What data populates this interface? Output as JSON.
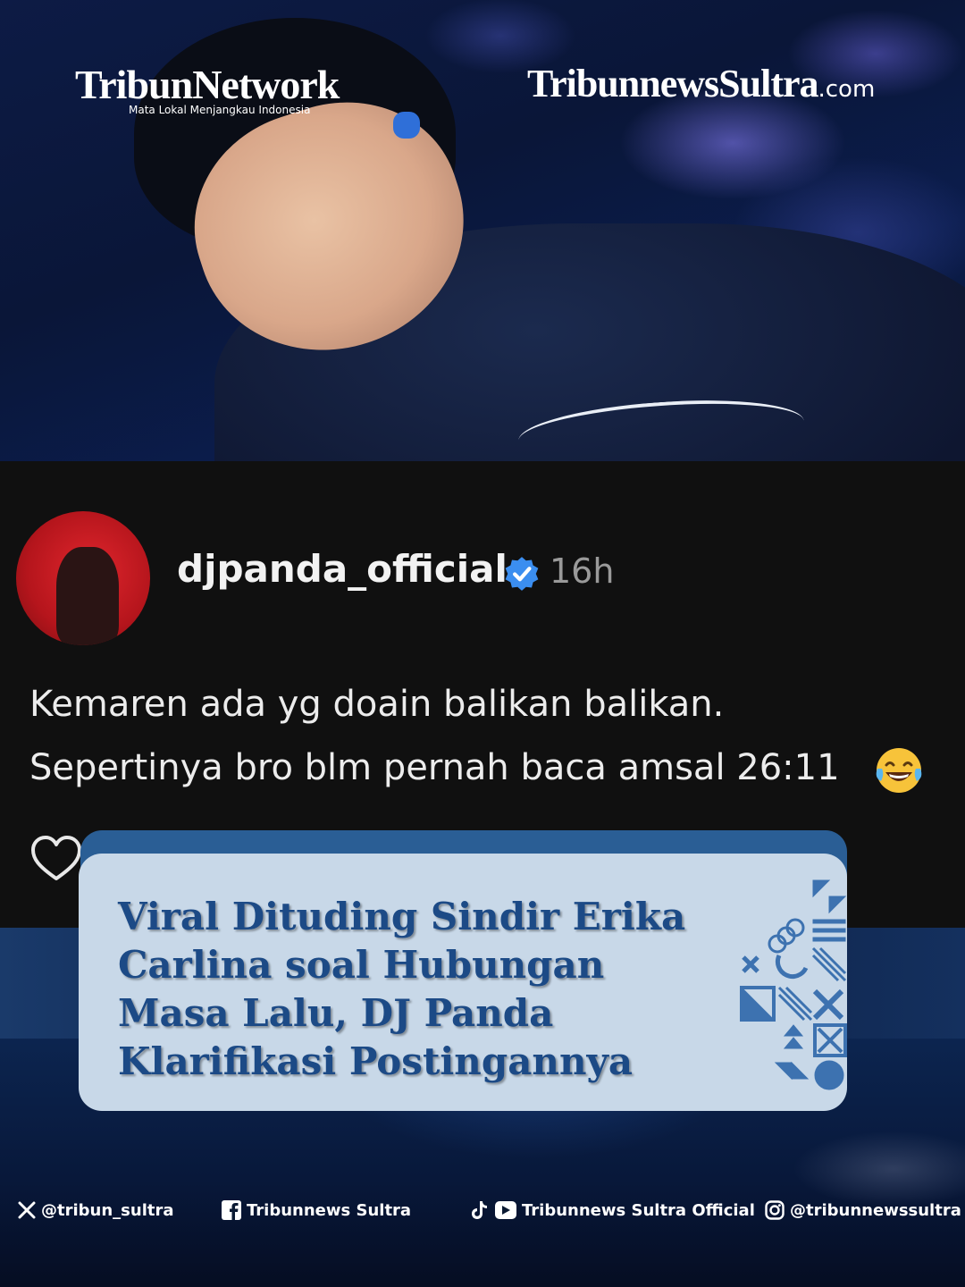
{
  "brands": {
    "network_main": "TribunNetwork",
    "network_tagline": "Mata Lokal Menjangkau Indonesia",
    "sultra_main": "TribunnewsSultra",
    "sultra_suffix": ".com"
  },
  "post": {
    "username": "djpanda_official",
    "time": "16h",
    "caption_line1": "Kemaren ada yg doain balikan balikan.",
    "caption_line2": "Sepertinya bro blm pernah baca amsal 26:11",
    "emoji_icon": "face-with-tears-of-joy-icon",
    "verified_icon": "verified-badge-icon",
    "like_icon": "heart-outline-icon"
  },
  "headline": {
    "text": "Viral Dituding Sindir Erika Carlina soal Hubungan Masa Lalu, DJ Panda Klarifikasi Postingannya"
  },
  "socials": [
    {
      "platform": "X",
      "icon": "x-icon",
      "label": "@tribun_sultra"
    },
    {
      "platform": "Facebook",
      "icon": "facebook-icon",
      "label": "Tribunnews Sultra"
    },
    {
      "platform": "TikTok/YouTube",
      "icon": "tiktok-youtube-icon",
      "label": "Tribunnews Sultra Official"
    },
    {
      "platform": "Instagram",
      "icon": "instagram-icon",
      "label": "@tribunnewssultra"
    }
  ],
  "colors": {
    "card_background": "#c8d8e8",
    "card_tab": "#2a5e95",
    "headline_text": "#1c4a86",
    "verified_blue": "#3b8ef0",
    "post_background": "#101010"
  }
}
